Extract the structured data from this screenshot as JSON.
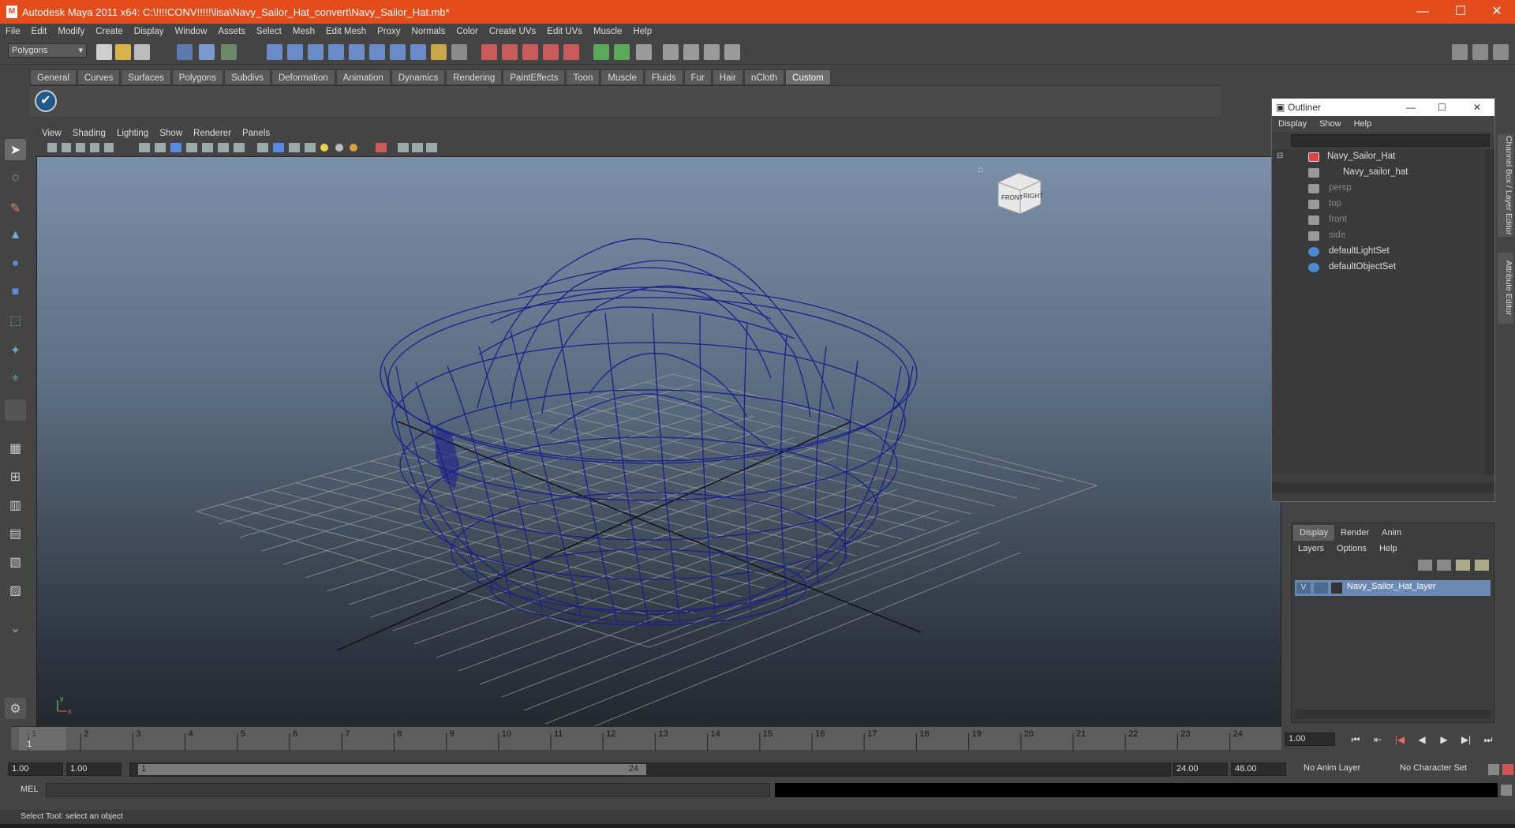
{
  "window": {
    "title": "Autodesk Maya 2011 x64: C:\\!!!!CONV!!!!!\\lisa\\Navy_Sailor_Hat_convert\\Navy_Sailor_Hat.mb*",
    "minimize": "—",
    "maximize": "☐",
    "close": "✕"
  },
  "menubar": [
    "File",
    "Edit",
    "Modify",
    "Create",
    "Display",
    "Window",
    "Assets",
    "Select",
    "Mesh",
    "Edit Mesh",
    "Proxy",
    "Normals",
    "Color",
    "Create UVs",
    "Edit UVs",
    "Muscle",
    "Help"
  ],
  "mode_selector": "Polygons",
  "shelf": {
    "tabs": [
      "General",
      "Curves",
      "Surfaces",
      "Polygons",
      "Subdivs",
      "Deformation",
      "Animation",
      "Dynamics",
      "Rendering",
      "PaintEffects",
      "Toon",
      "Muscle",
      "Fluids",
      "Fur",
      "Hair",
      "nCloth",
      "Custom"
    ],
    "active_tab": "Custom",
    "button_icon": "check-icon"
  },
  "viewport": {
    "menu": [
      "View",
      "Shading",
      "Lighting",
      "Show",
      "Renderer",
      "Panels"
    ],
    "viewcube": {
      "front": "FRONT",
      "right": "RIGHT"
    },
    "axis": {
      "x": "x",
      "y": "y"
    },
    "wireframe_color": "#1a1f8c"
  },
  "outliner": {
    "title": "Outliner",
    "menu": [
      "Display",
      "Show",
      "Help"
    ],
    "items": [
      {
        "label": "Navy_Sailor_Hat",
        "dim": false
      },
      {
        "label": "Navy_sailor_hat",
        "dim": false
      },
      {
        "label": "persp",
        "dim": true
      },
      {
        "label": "top",
        "dim": true
      },
      {
        "label": "front",
        "dim": true
      },
      {
        "label": "side",
        "dim": true
      },
      {
        "label": "defaultLightSet",
        "dim": false
      },
      {
        "label": "defaultObjectSet",
        "dim": false
      }
    ]
  },
  "right_tabs": {
    "channel_box": "Channel Box / Layer Editor",
    "attribute_editor": "Attribute Editor"
  },
  "layer_editor": {
    "tabs": [
      "Display",
      "Render",
      "Anim"
    ],
    "menu": [
      "Layers",
      "Options",
      "Help"
    ],
    "layer": {
      "visible": "V",
      "name": "Navy_Sailor_Hat_layer"
    }
  },
  "timeline": {
    "ticks": [
      "1",
      "2",
      "3",
      "4",
      "5",
      "6",
      "7",
      "8",
      "9",
      "10",
      "11",
      "12",
      "13",
      "14",
      "15",
      "16",
      "17",
      "18",
      "19",
      "20",
      "21",
      "22",
      "23",
      "24"
    ],
    "current": "1",
    "current_time_field": "1.00"
  },
  "range": {
    "start": "1.00",
    "playback_start": "1.00",
    "slider_start": "1",
    "slider_end": "24",
    "playback_end": "24.00",
    "end": "48.00",
    "anim_layer": "No Anim Layer",
    "character_set": "No Character Set"
  },
  "command": {
    "label": "MEL"
  },
  "help_line": "Select Tool: select an object",
  "playback": [
    "⏮",
    "⇤",
    "|◀",
    "◀",
    "▶",
    "▶|",
    "⏭"
  ]
}
